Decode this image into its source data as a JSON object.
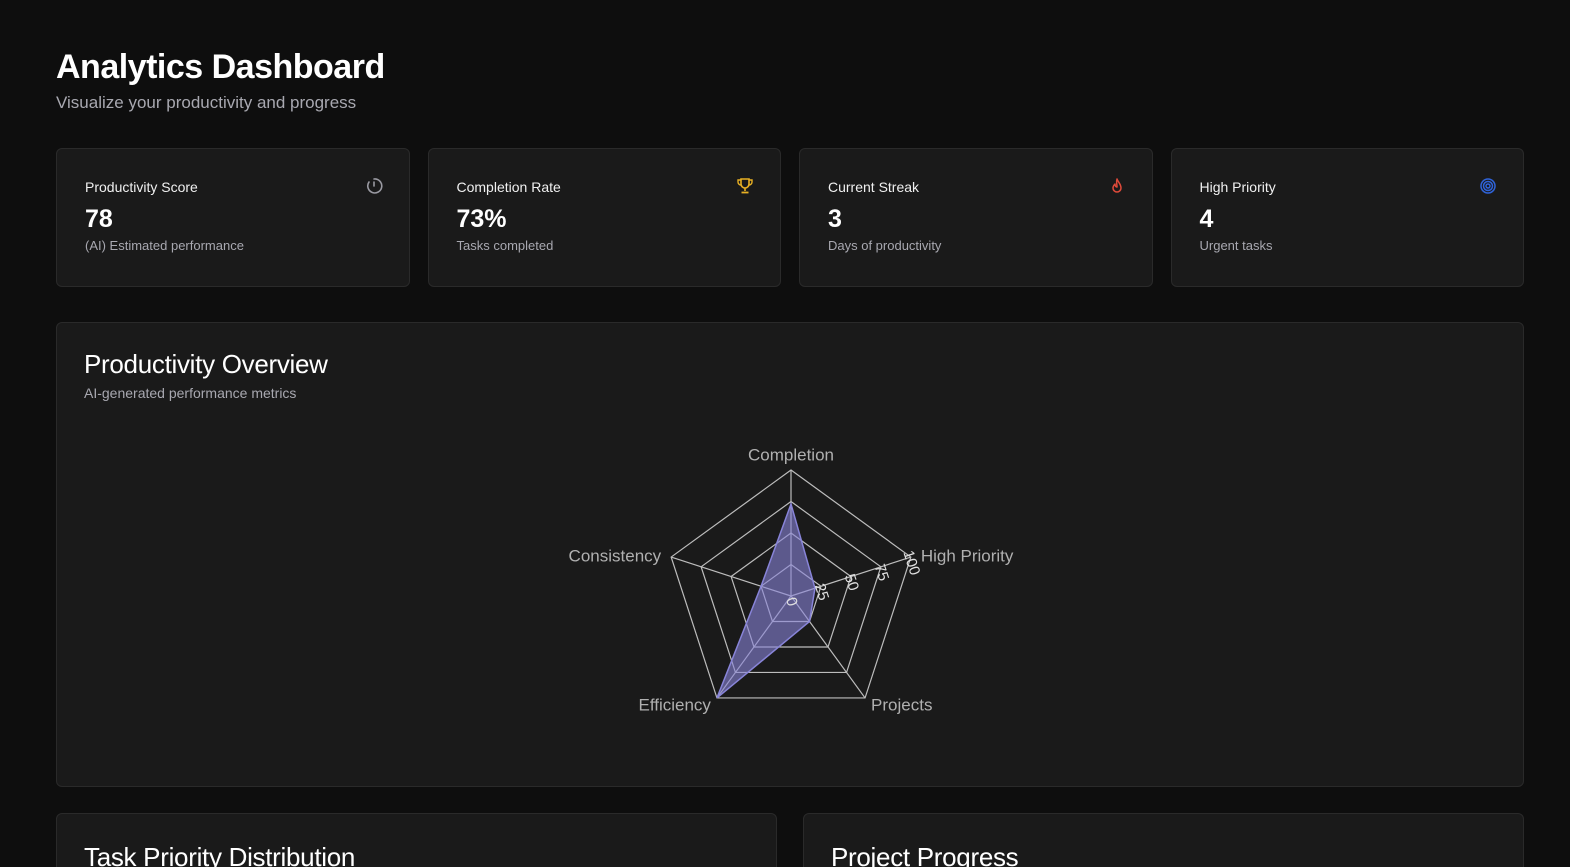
{
  "header": {
    "title": "Analytics Dashboard",
    "subtitle": "Visualize your productivity and progress"
  },
  "stats": [
    {
      "label": "Productivity Score",
      "value": "78",
      "desc": "(AI) Estimated performance",
      "icon": "gauge-icon",
      "color": "#9a9aa2"
    },
    {
      "label": "Completion Rate",
      "value": "73%",
      "desc": "Tasks completed",
      "icon": "trophy-icon",
      "color": "#e8b023"
    },
    {
      "label": "Current Streak",
      "value": "3",
      "desc": "Days of productivity",
      "icon": "flame-icon",
      "color": "#e04a3a"
    },
    {
      "label": "High Priority",
      "value": "4",
      "desc": "Urgent tasks",
      "icon": "target-icon",
      "color": "#2f63d9"
    }
  ],
  "overview": {
    "title": "Productivity Overview",
    "subtitle": "AI-generated performance metrics"
  },
  "chart_data": {
    "type": "radar",
    "axes": [
      "Completion",
      "High Priority",
      "Projects",
      "Efficiency",
      "Consistency"
    ],
    "ticks": [
      "0",
      "25",
      "50",
      "75",
      "100"
    ],
    "range": [
      0,
      100
    ],
    "values": [
      73,
      20,
      25,
      100,
      25
    ],
    "fill_color": "#8884d8",
    "grid_color": "#bdbdbd"
  },
  "bottom": {
    "priority_title": "Task Priority Distribution",
    "progress_title": "Project Progress"
  }
}
